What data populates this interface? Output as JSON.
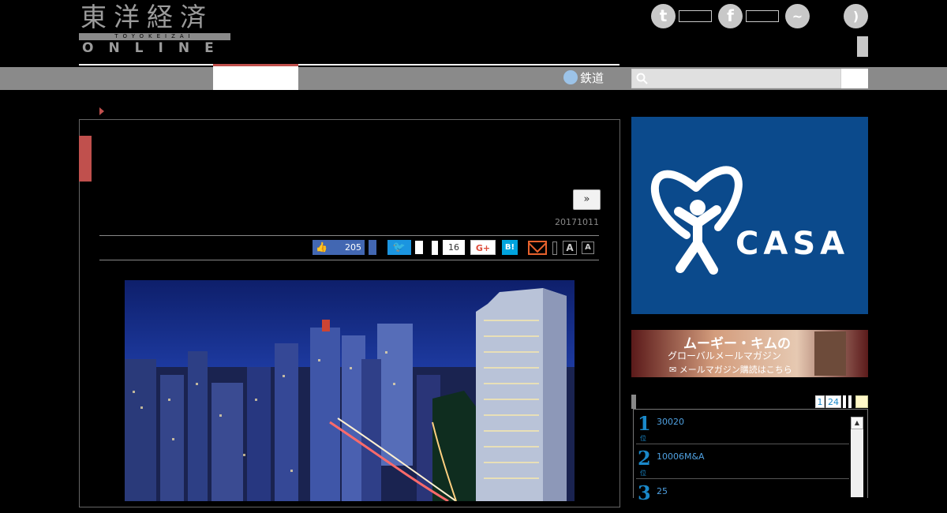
{
  "header": {
    "logo_kanji": "東洋経済",
    "logo_sub": "TOYOKEIZAI",
    "logo_online": "ONLINE",
    "social": [
      {
        "icon": "twitter-icon",
        "glyph": "t"
      },
      {
        "icon": "facebook-icon",
        "glyph": "f"
      },
      {
        "icon": "messenger-icon",
        "glyph": "~"
      },
      {
        "icon": "rss-icon",
        "glyph": ")"
      }
    ]
  },
  "nav": {
    "rail_label": "鉄道",
    "search_placeholder": ""
  },
  "article": {
    "next_label": "»",
    "date": "20171011",
    "share": {
      "like_count": "205",
      "tweet_count": "16",
      "gplus_label": "G+",
      "hatena_label": "B!",
      "font_small": "A",
      "font_large": "A"
    },
    "photo_alt": "Tokyo skyline at night"
  },
  "sidebar": {
    "ad_label": "CASA",
    "banner2": {
      "line1": "ムーギー・キムの",
      "line2": "グローバルメールマガジン",
      "line3": "✉ メールマガジン購読はこちら"
    },
    "ranking": {
      "tabs": [
        "1",
        "24"
      ],
      "items": [
        {
          "rank": "1",
          "suffix": "位",
          "title": "30020"
        },
        {
          "rank": "2",
          "suffix": "位",
          "title": "10006M&A"
        },
        {
          "rank": "3",
          "suffix": "位",
          "title": "25"
        }
      ]
    }
  }
}
